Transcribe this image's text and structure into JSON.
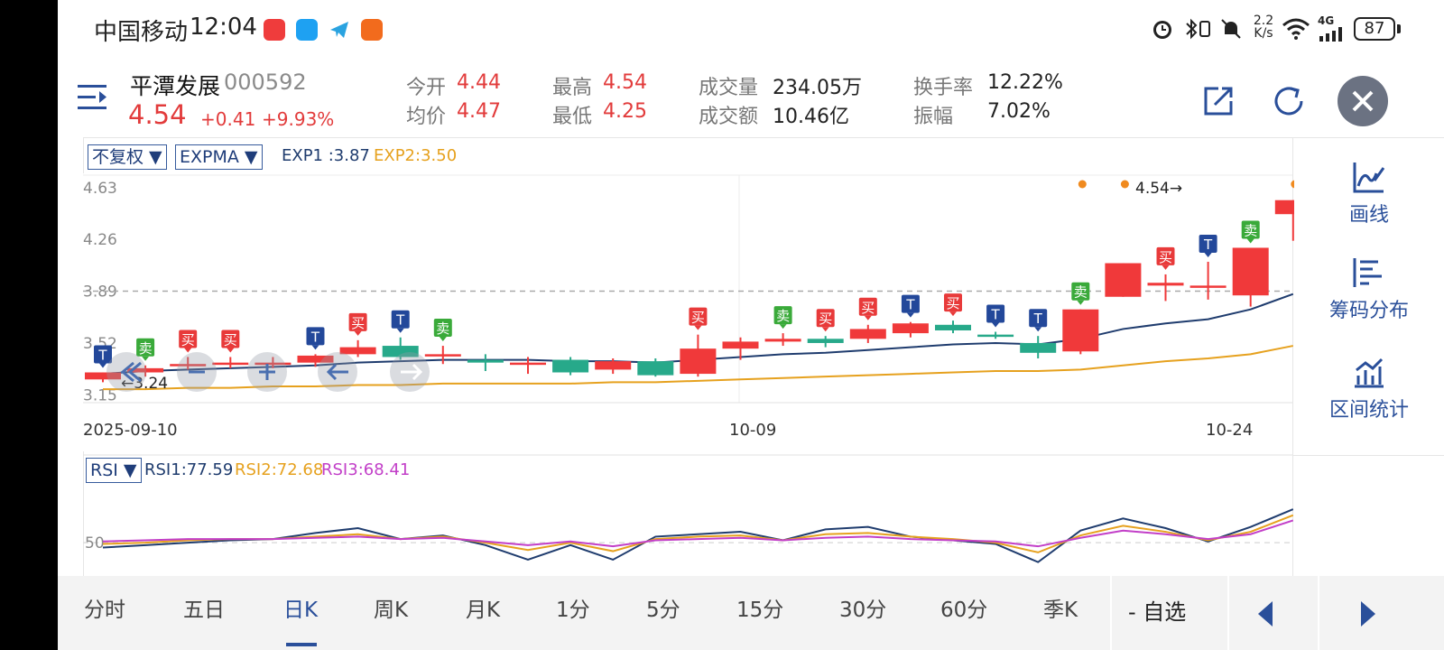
{
  "status_bar": {
    "carrier": "中国移动",
    "time": "12:04",
    "net_speed_top": "2.2",
    "net_speed_bottom": "K/s",
    "network_type": "4G",
    "battery": "87"
  },
  "header": {
    "name": "平潭发展",
    "code": "000592",
    "price": "4.54",
    "change": "+0.41",
    "change_pct": "+9.93%",
    "stats": [
      {
        "label": "今开",
        "value": "4.44"
      },
      {
        "label": "均价",
        "value": "4.47"
      },
      {
        "label": "最高",
        "value": "4.54"
      },
      {
        "label": "最低",
        "value": "4.25"
      },
      {
        "label": "成交量",
        "value": "234.05万"
      },
      {
        "label": "成交额",
        "value": "10.46亿"
      },
      {
        "label": "换手率",
        "value": "12.22%"
      },
      {
        "label": "振幅",
        "value": "7.02%"
      }
    ]
  },
  "chart_controls": {
    "adjust": "不复权 ▼",
    "indicator": "EXPMA ▼",
    "exp1": "EXP1 :3.87",
    "exp2": "EXP2:3.50",
    "rsi_selector": "RSI ▼",
    "rsi1": "RSI1:77.59",
    "rsi2": "RSI2:72.68",
    "rsi3": "RSI3:68.41"
  },
  "chart_data": [
    {
      "type": "candlestick",
      "x_tick_labels": [
        "2025-09-10",
        "10-09",
        "10-24"
      ],
      "y_tick_labels": [
        "4.63",
        "4.26",
        "3.89",
        "3.52",
        "3.15"
      ],
      "ylim": [
        3.12,
        4.68
      ],
      "reference_line": 3.89,
      "annotations": {
        "high": "4.54→",
        "low": "←3.24"
      },
      "candles": [
        {
          "o": 3.26,
          "h": 3.31,
          "l": 3.24,
          "c": 3.31
        },
        {
          "o": 3.31,
          "h": 3.36,
          "l": 3.28,
          "c": 3.34
        },
        {
          "o": 3.37,
          "h": 3.42,
          "l": 3.33,
          "c": 3.37
        },
        {
          "o": 3.37,
          "h": 3.42,
          "l": 3.34,
          "c": 3.38
        },
        {
          "o": 3.38,
          "h": 3.42,
          "l": 3.34,
          "c": 3.38
        },
        {
          "o": 3.38,
          "h": 3.44,
          "l": 3.35,
          "c": 3.43
        },
        {
          "o": 3.44,
          "h": 3.54,
          "l": 3.42,
          "c": 3.49
        },
        {
          "o": 3.5,
          "h": 3.56,
          "l": 3.4,
          "c": 3.42
        },
        {
          "o": 3.44,
          "h": 3.5,
          "l": 3.37,
          "c": 3.44
        },
        {
          "o": 3.4,
          "h": 3.44,
          "l": 3.32,
          "c": 3.38
        },
        {
          "o": 3.38,
          "h": 3.42,
          "l": 3.3,
          "c": 3.38
        },
        {
          "o": 3.4,
          "h": 3.42,
          "l": 3.29,
          "c": 3.31
        },
        {
          "o": 3.33,
          "h": 3.41,
          "l": 3.3,
          "c": 3.39
        },
        {
          "o": 3.39,
          "h": 3.41,
          "l": 3.28,
          "c": 3.29
        },
        {
          "o": 3.3,
          "h": 3.58,
          "l": 3.28,
          "c": 3.48
        },
        {
          "o": 3.48,
          "h": 3.56,
          "l": 3.4,
          "c": 3.53
        },
        {
          "o": 3.53,
          "h": 3.59,
          "l": 3.5,
          "c": 3.55
        },
        {
          "o": 3.55,
          "h": 3.57,
          "l": 3.49,
          "c": 3.52
        },
        {
          "o": 3.55,
          "h": 3.65,
          "l": 3.52,
          "c": 3.62
        },
        {
          "o": 3.59,
          "h": 3.67,
          "l": 3.56,
          "c": 3.66
        },
        {
          "o": 3.65,
          "h": 3.68,
          "l": 3.59,
          "c": 3.61
        },
        {
          "o": 3.58,
          "h": 3.6,
          "l": 3.55,
          "c": 3.57
        },
        {
          "o": 3.52,
          "h": 3.57,
          "l": 3.41,
          "c": 3.45
        },
        {
          "o": 3.46,
          "h": 3.76,
          "l": 3.44,
          "c": 3.76
        },
        {
          "o": 3.85,
          "h": 4.09,
          "l": 3.85,
          "c": 4.09
        },
        {
          "o": 3.93,
          "h": 4.01,
          "l": 3.82,
          "c": 3.95
        },
        {
          "o": 3.92,
          "h": 4.1,
          "l": 3.83,
          "c": 3.93
        },
        {
          "o": 3.86,
          "h": 4.2,
          "l": 3.78,
          "c": 4.2
        },
        {
          "o": 4.44,
          "h": 4.54,
          "l": 4.25,
          "c": 4.54
        }
      ],
      "series": [
        {
          "name": "EXP1",
          "color": "#1f3c6e",
          "values": [
            3.3,
            3.32,
            3.33,
            3.34,
            3.35,
            3.36,
            3.38,
            3.39,
            3.4,
            3.4,
            3.4,
            3.39,
            3.39,
            3.38,
            3.4,
            3.42,
            3.44,
            3.45,
            3.47,
            3.49,
            3.51,
            3.52,
            3.51,
            3.55,
            3.62,
            3.66,
            3.69,
            3.76,
            3.87
          ]
        },
        {
          "name": "EXP2",
          "color": "#e6a11e",
          "values": [
            3.19,
            3.19,
            3.2,
            3.2,
            3.21,
            3.21,
            3.22,
            3.22,
            3.23,
            3.23,
            3.23,
            3.23,
            3.24,
            3.24,
            3.25,
            3.26,
            3.27,
            3.28,
            3.29,
            3.3,
            3.31,
            3.32,
            3.32,
            3.33,
            3.36,
            3.39,
            3.41,
            3.44,
            3.5
          ]
        }
      ],
      "signals": [
        {
          "i": 0,
          "type": "T"
        },
        {
          "i": 1,
          "type": "卖"
        },
        {
          "i": 2,
          "type": "买"
        },
        {
          "i": 3,
          "type": "买"
        },
        {
          "i": 5,
          "type": "T"
        },
        {
          "i": 6,
          "type": "买"
        },
        {
          "i": 7,
          "type": "T"
        },
        {
          "i": 8,
          "type": "卖"
        },
        {
          "i": 14,
          "type": "买"
        },
        {
          "i": 16,
          "type": "卖"
        },
        {
          "i": 17,
          "type": "买"
        },
        {
          "i": 18,
          "type": "买"
        },
        {
          "i": 19,
          "type": "T"
        },
        {
          "i": 20,
          "type": "买"
        },
        {
          "i": 21,
          "type": "T"
        },
        {
          "i": 22,
          "type": "T"
        },
        {
          "i": 23,
          "type": "卖"
        },
        {
          "i": 25,
          "type": "买"
        },
        {
          "i": 26,
          "type": "T"
        },
        {
          "i": 27,
          "type": "卖"
        }
      ],
      "dots": [
        23,
        24,
        28
      ]
    },
    {
      "type": "line",
      "y_tick_labels": [
        "50"
      ],
      "ylim": [
        30,
        100
      ],
      "series": [
        {
          "name": "RSI1",
          "color": "#1f3c6e",
          "values": [
            46,
            48,
            50,
            52,
            53,
            58,
            62,
            53,
            56,
            48,
            36,
            48,
            36,
            55,
            57,
            59,
            52,
            61,
            63,
            55,
            52,
            49,
            34,
            60,
            70,
            62,
            51,
            63,
            77.59
          ]
        },
        {
          "name": "RSI2",
          "color": "#e6a11e",
          "values": [
            49,
            50,
            52,
            53,
            53,
            55,
            57,
            53,
            55,
            50,
            44,
            50,
            43,
            53,
            55,
            56,
            52,
            57,
            58,
            55,
            53,
            50,
            42,
            56,
            64,
            59,
            52,
            59,
            72.68
          ]
        },
        {
          "name": "RSI3",
          "color": "#c23fc8",
          "values": [
            51,
            52,
            53,
            53,
            53,
            54,
            55,
            53,
            54,
            51,
            48,
            51,
            47,
            52,
            53,
            54,
            52,
            54,
            55,
            53,
            52,
            51,
            47,
            54,
            60,
            57,
            53,
            57,
            68.41
          ]
        }
      ]
    }
  ],
  "side_menu": [
    {
      "label": "画线",
      "icon": "draw-line-icon"
    },
    {
      "label": "筹码分布",
      "icon": "chip-distribution-icon"
    },
    {
      "label": "区间统计",
      "icon": "interval-stats-icon"
    }
  ],
  "bottom_tabs": [
    "分时",
    "五日",
    "日K",
    "周K",
    "月K",
    "1分",
    "5分",
    "15分",
    "30分",
    "60分",
    "季K"
  ],
  "active_tab": 2,
  "watchlist_button": "- 自选",
  "colors": {
    "up": "#f0393a",
    "down": "#27a98a",
    "accent": "#2a4f9a",
    "exp1": "#1f3c6e",
    "exp2": "#e6a11e",
    "rsi3": "#c23fc8"
  }
}
